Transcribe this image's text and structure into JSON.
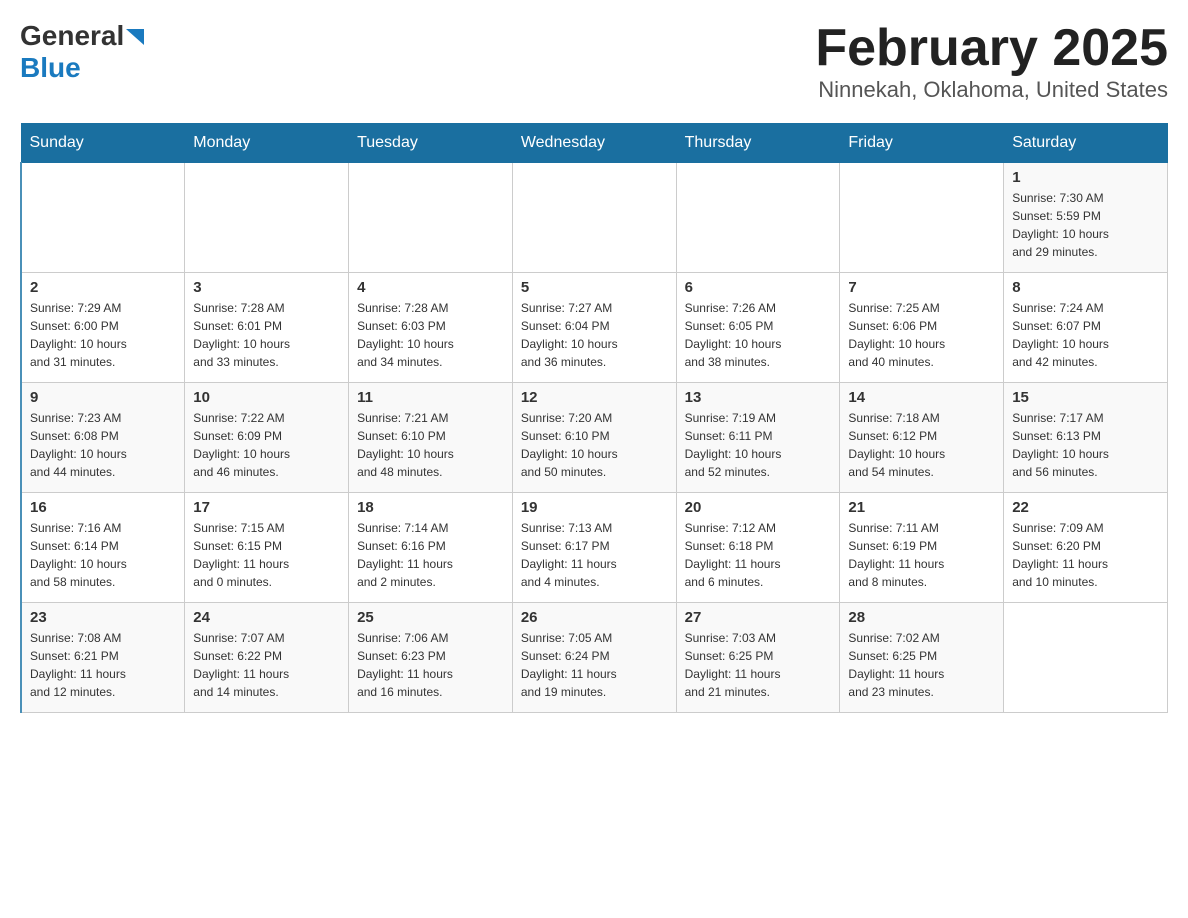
{
  "header": {
    "logo_general": "General",
    "logo_blue": "Blue",
    "title": "February 2025",
    "subtitle": "Ninnekah, Oklahoma, United States"
  },
  "days_of_week": [
    "Sunday",
    "Monday",
    "Tuesday",
    "Wednesday",
    "Thursday",
    "Friday",
    "Saturday"
  ],
  "weeks": [
    [
      {
        "day": "",
        "info": ""
      },
      {
        "day": "",
        "info": ""
      },
      {
        "day": "",
        "info": ""
      },
      {
        "day": "",
        "info": ""
      },
      {
        "day": "",
        "info": ""
      },
      {
        "day": "",
        "info": ""
      },
      {
        "day": "1",
        "info": "Sunrise: 7:30 AM\nSunset: 5:59 PM\nDaylight: 10 hours\nand 29 minutes."
      }
    ],
    [
      {
        "day": "2",
        "info": "Sunrise: 7:29 AM\nSunset: 6:00 PM\nDaylight: 10 hours\nand 31 minutes."
      },
      {
        "day": "3",
        "info": "Sunrise: 7:28 AM\nSunset: 6:01 PM\nDaylight: 10 hours\nand 33 minutes."
      },
      {
        "day": "4",
        "info": "Sunrise: 7:28 AM\nSunset: 6:03 PM\nDaylight: 10 hours\nand 34 minutes."
      },
      {
        "day": "5",
        "info": "Sunrise: 7:27 AM\nSunset: 6:04 PM\nDaylight: 10 hours\nand 36 minutes."
      },
      {
        "day": "6",
        "info": "Sunrise: 7:26 AM\nSunset: 6:05 PM\nDaylight: 10 hours\nand 38 minutes."
      },
      {
        "day": "7",
        "info": "Sunrise: 7:25 AM\nSunset: 6:06 PM\nDaylight: 10 hours\nand 40 minutes."
      },
      {
        "day": "8",
        "info": "Sunrise: 7:24 AM\nSunset: 6:07 PM\nDaylight: 10 hours\nand 42 minutes."
      }
    ],
    [
      {
        "day": "9",
        "info": "Sunrise: 7:23 AM\nSunset: 6:08 PM\nDaylight: 10 hours\nand 44 minutes."
      },
      {
        "day": "10",
        "info": "Sunrise: 7:22 AM\nSunset: 6:09 PM\nDaylight: 10 hours\nand 46 minutes."
      },
      {
        "day": "11",
        "info": "Sunrise: 7:21 AM\nSunset: 6:10 PM\nDaylight: 10 hours\nand 48 minutes."
      },
      {
        "day": "12",
        "info": "Sunrise: 7:20 AM\nSunset: 6:10 PM\nDaylight: 10 hours\nand 50 minutes."
      },
      {
        "day": "13",
        "info": "Sunrise: 7:19 AM\nSunset: 6:11 PM\nDaylight: 10 hours\nand 52 minutes."
      },
      {
        "day": "14",
        "info": "Sunrise: 7:18 AM\nSunset: 6:12 PM\nDaylight: 10 hours\nand 54 minutes."
      },
      {
        "day": "15",
        "info": "Sunrise: 7:17 AM\nSunset: 6:13 PM\nDaylight: 10 hours\nand 56 minutes."
      }
    ],
    [
      {
        "day": "16",
        "info": "Sunrise: 7:16 AM\nSunset: 6:14 PM\nDaylight: 10 hours\nand 58 minutes."
      },
      {
        "day": "17",
        "info": "Sunrise: 7:15 AM\nSunset: 6:15 PM\nDaylight: 11 hours\nand 0 minutes."
      },
      {
        "day": "18",
        "info": "Sunrise: 7:14 AM\nSunset: 6:16 PM\nDaylight: 11 hours\nand 2 minutes."
      },
      {
        "day": "19",
        "info": "Sunrise: 7:13 AM\nSunset: 6:17 PM\nDaylight: 11 hours\nand 4 minutes."
      },
      {
        "day": "20",
        "info": "Sunrise: 7:12 AM\nSunset: 6:18 PM\nDaylight: 11 hours\nand 6 minutes."
      },
      {
        "day": "21",
        "info": "Sunrise: 7:11 AM\nSunset: 6:19 PM\nDaylight: 11 hours\nand 8 minutes."
      },
      {
        "day": "22",
        "info": "Sunrise: 7:09 AM\nSunset: 6:20 PM\nDaylight: 11 hours\nand 10 minutes."
      }
    ],
    [
      {
        "day": "23",
        "info": "Sunrise: 7:08 AM\nSunset: 6:21 PM\nDaylight: 11 hours\nand 12 minutes."
      },
      {
        "day": "24",
        "info": "Sunrise: 7:07 AM\nSunset: 6:22 PM\nDaylight: 11 hours\nand 14 minutes."
      },
      {
        "day": "25",
        "info": "Sunrise: 7:06 AM\nSunset: 6:23 PM\nDaylight: 11 hours\nand 16 minutes."
      },
      {
        "day": "26",
        "info": "Sunrise: 7:05 AM\nSunset: 6:24 PM\nDaylight: 11 hours\nand 19 minutes."
      },
      {
        "day": "27",
        "info": "Sunrise: 7:03 AM\nSunset: 6:25 PM\nDaylight: 11 hours\nand 21 minutes."
      },
      {
        "day": "28",
        "info": "Sunrise: 7:02 AM\nSunset: 6:25 PM\nDaylight: 11 hours\nand 23 minutes."
      },
      {
        "day": "",
        "info": ""
      }
    ]
  ]
}
